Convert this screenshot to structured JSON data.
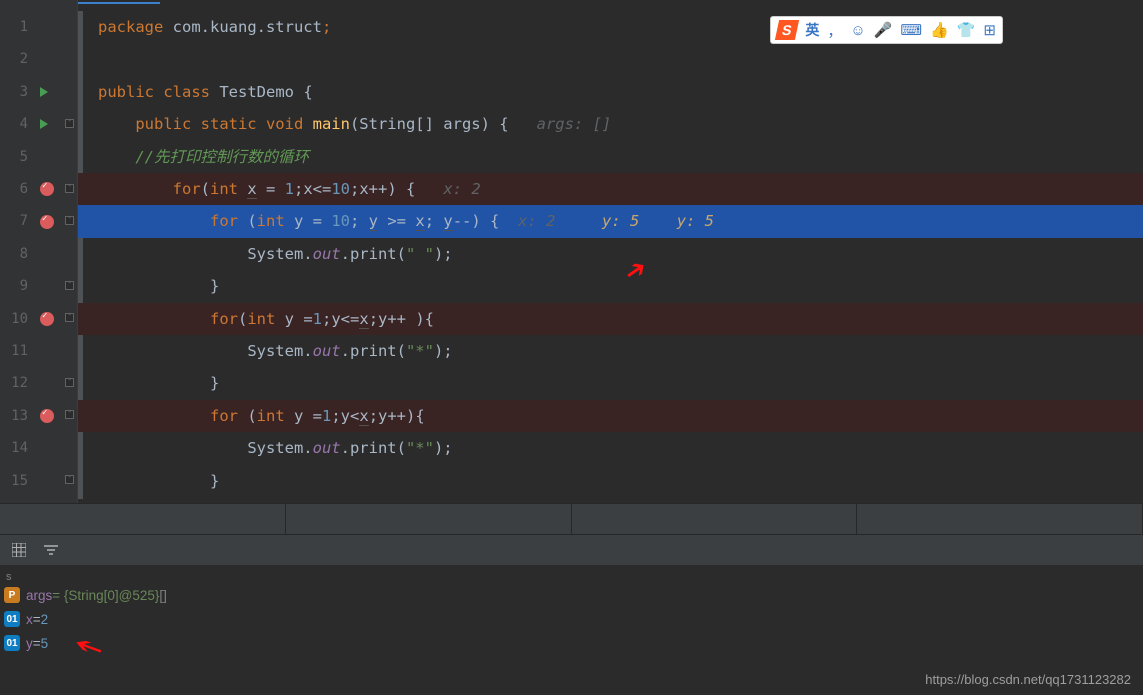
{
  "code": {
    "package_kw": "package",
    "package": " com.kuang.struct",
    "class_kw": "public class ",
    "class_name": "TestDemo",
    " brace": " {",
    "main_kw": "public static void ",
    "main_fn": "main",
    "main_args": "(String[] args) {   ",
    "main_hint": "args: []",
    "cmt": "//先打印控制行数的循环",
    "for1_a": "for",
    "for1_b": "(",
    "for1_int": "int ",
    "for1_x": "x",
    "for1_eq": " = ",
    "for1_1": "1",
    "for1_c": ";x<=",
    "for1_10": "10",
    "for1_d": ";x++) {   ",
    "for1_hint": "x: 2",
    "for2_a": "for ",
    "for2_b": "(",
    "for2_int": "int ",
    "for2_y": "y",
    "for2_eq": " = ",
    "for2_10": "10",
    "for2_c": "; ",
    "for2_y2": "y",
    "for2_d": " >= ",
    "for2_x": "x",
    "for2_e": "; ",
    "for2_y3": "y",
    "for2_f": "--) {  ",
    "for2_h1": "x: 2",
    "for2_gap": "     ",
    "for2_h2": "y: 5",
    "for2_gap2": "    ",
    "for2_h3": "y: 5",
    "p1_a": "System.",
    "p1_out": "out",
    "p1_b": ".print(",
    "p1_s": "\" \"",
    "p1_c": ");",
    "brace_close": "}",
    "for3_a": "for",
    "for3_b": "(",
    "for3_int": "int ",
    "for3_y": "y",
    "for3_eq": " =",
    "for3_1": "1",
    "for3_c": ";y<=",
    "for3_x": "x",
    "for3_d": ";y++ ){",
    "p2_a": "System.",
    "p2_out": "out",
    "p2_b": ".print(",
    "p2_s": "\"*\"",
    "p2_c": ");",
    "for4_a": "for ",
    "for4_b": "(",
    "for4_int": "int ",
    "for4_y": "y",
    "for4_eq": " =",
    "for4_1": "1",
    "for4_c": ";y<",
    "for4_x": "x",
    "for4_d": ";y++){",
    "p3_a": "System.",
    "p3_out": "out",
    "p3_b": ".print(",
    "p3_s": "\"*\"",
    "p3_c": ");"
  },
  "ime": {
    "lang": "英",
    "comma": "，",
    "smile": "☺",
    "mic": "🎤",
    "kb": "⌨",
    "hand": "👍",
    "shirt": "👕",
    "grid": "⊞"
  },
  "vars": {
    "args_name": "args",
    "args_val": " = {String[0]@525} ",
    "args_arr": "[]",
    "x_name": "x",
    "x_eq": " = ",
    "x_val": "2",
    "y_name": "y",
    "y_eq": " = ",
    "y_val": "5"
  },
  "watermark": "https://blog.csdn.net/qq1731123282",
  "lines": [
    "1",
    "2",
    "3",
    "4",
    "5",
    "6",
    "7",
    "8",
    "9",
    "10",
    "11",
    "12",
    "13",
    "14",
    "15"
  ]
}
